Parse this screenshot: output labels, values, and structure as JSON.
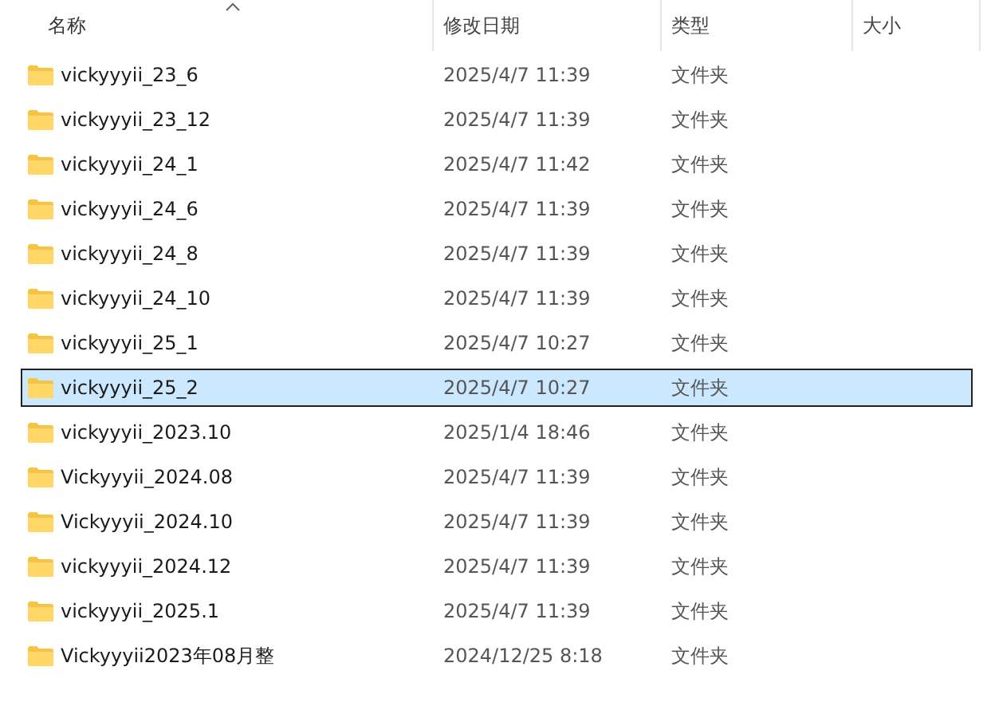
{
  "columns": [
    {
      "label": "名称",
      "sorted": true
    },
    {
      "label": "修改日期",
      "sorted": false
    },
    {
      "label": "类型",
      "sorted": false
    },
    {
      "label": "大小",
      "sorted": false
    }
  ],
  "rows": [
    {
      "name": "vickyyyii_23_6",
      "modified": "2025/4/7 11:39",
      "type": "文件夹",
      "selected": false
    },
    {
      "name": "vickyyyii_23_12",
      "modified": "2025/4/7 11:39",
      "type": "文件夹",
      "selected": false
    },
    {
      "name": "vickyyyii_24_1",
      "modified": "2025/4/7 11:42",
      "type": "文件夹",
      "selected": false
    },
    {
      "name": "vickyyyii_24_6",
      "modified": "2025/4/7 11:39",
      "type": "文件夹",
      "selected": false
    },
    {
      "name": "vickyyyii_24_8",
      "modified": "2025/4/7 11:39",
      "type": "文件夹",
      "selected": false
    },
    {
      "name": "vickyyyii_24_10",
      "modified": "2025/4/7 11:39",
      "type": "文件夹",
      "selected": false
    },
    {
      "name": "vickyyyii_25_1",
      "modified": "2025/4/7 10:27",
      "type": "文件夹",
      "selected": false
    },
    {
      "name": "vickyyyii_25_2",
      "modified": "2025/4/7 10:27",
      "type": "文件夹",
      "selected": true
    },
    {
      "name": "vickyyyii_2023.10",
      "modified": "2025/1/4 18:46",
      "type": "文件夹",
      "selected": false
    },
    {
      "name": "Vickyyyii_2024.08",
      "modified": "2025/4/7 11:39",
      "type": "文件夹",
      "selected": false
    },
    {
      "name": "Vickyyyii_2024.10",
      "modified": "2025/4/7 11:39",
      "type": "文件夹",
      "selected": false
    },
    {
      "name": "vickyyyii_2024.12",
      "modified": "2025/4/7 11:39",
      "type": "文件夹",
      "selected": false
    },
    {
      "name": "vickyyyii_2025.1",
      "modified": "2025/4/7 11:39",
      "type": "文件夹",
      "selected": false
    },
    {
      "name": "Vickyyyii2023年08月整",
      "modified": "2024/12/25 8:18",
      "type": "文件夹",
      "selected": false
    }
  ]
}
